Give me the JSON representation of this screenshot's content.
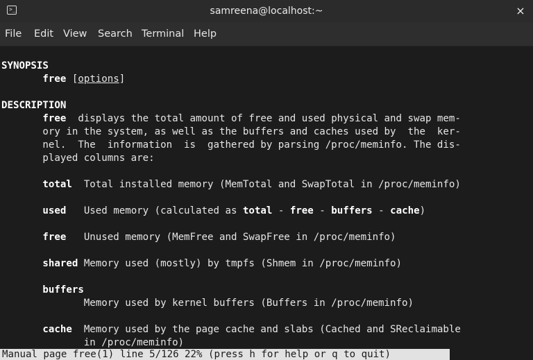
{
  "window": {
    "title": "samreena@localhost:~",
    "close_glyph": "×",
    "icon": "terminal-icon"
  },
  "menu": {
    "items": [
      "File",
      "Edit",
      "View",
      "Search",
      "Terminal",
      "Help"
    ]
  },
  "terminal": {
    "synopsis_heading": "SYNOPSIS",
    "synopsis_cmd": "free",
    "synopsis_options": "options",
    "description_heading": "DESCRIPTION",
    "desc_l1_cmd": "free",
    "desc_l1_rest": "  displays the total amount of free and used physical and swap mem-",
    "desc_l2": "ory in the system, as well as the buffers and caches used by  the  ker-",
    "desc_l3": "nel.  The  information  is  gathered by parsing /proc/meminfo. The dis-",
    "desc_l4": "played columns are:",
    "total_term": "total",
    "total_desc": "  Total installed memory (MemTotal and SwapTotal in /proc/meminfo)",
    "used_term": "used",
    "used_desc_a": "   Used memory (calculated as ",
    "used_b1": "total",
    "used_sep1": " - ",
    "used_b2": "free",
    "used_sep2": " - ",
    "used_b3": "buffers",
    "used_sep3": " - ",
    "used_b4": "cache",
    "used_close": ")",
    "free_term": "free",
    "free_desc": "   Unused memory (MemFree and SwapFree in /proc/meminfo)",
    "shared_term": "shared",
    "shared_desc": " Memory used (mostly) by tmpfs (Shmem in /proc/meminfo)",
    "buffers_term": "buffers",
    "buffers_desc": "Memory used by kernel buffers (Buffers in /proc/meminfo)",
    "cache_term": "cache",
    "cache_desc_1": "  Memory used by the page cache and slabs (Cached and SReclaimable",
    "cache_desc_2": "in /proc/meminfo)",
    "status_line": "Manual page free(1) line 5/126 22% (press h for help or q to quit)"
  }
}
